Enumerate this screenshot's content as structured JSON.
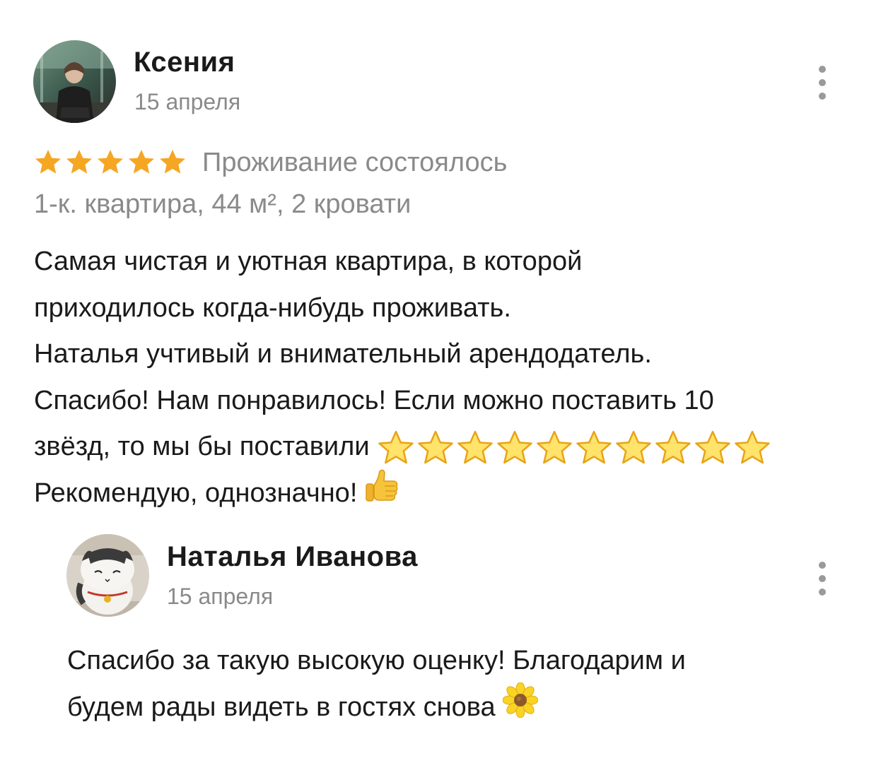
{
  "review": {
    "author": {
      "name": "Ксения",
      "date": "15 апреля",
      "avatar_icon": "user-photo-avatar"
    },
    "menu_icon": "more-vertical-icon",
    "rating": {
      "value": 5,
      "max": 5,
      "star_color": "#F5A623"
    },
    "stay_status": "Проживание состоялось",
    "listing_info": "1-к. квартира, 44 м², 2 кровати",
    "text_lines": [
      "Самая чистая и уютная квартира, в которой",
      "приходилось когда-нибудь проживать.",
      "Наталья учтивый и внимательный арендодатель.",
      "Спасибо! Нам понравилось! Если можно поставить 10",
      "звёзд, то мы бы поставили",
      "Рекомендую, однозначно!"
    ],
    "emoji_star_count": 10,
    "emoji_icons": [
      "star-emoji-icon",
      "thumbs-up-emoji-icon"
    ]
  },
  "reply": {
    "author": {
      "name": "Наталья Иванова",
      "date": "15 апреля",
      "avatar_icon": "cat-toy-avatar"
    },
    "menu_icon": "more-vertical-icon",
    "text_lines": [
      "Спасибо за такую высокую оценку! Благодарим и",
      "будем рады видеть в гостях снова"
    ],
    "emoji_icon": "flower-emoji-icon"
  }
}
